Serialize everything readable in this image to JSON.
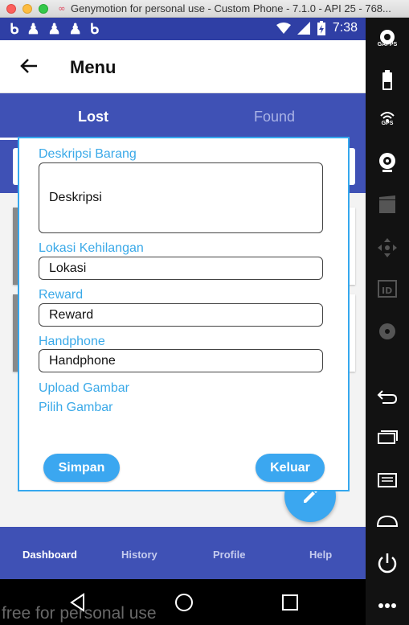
{
  "window": {
    "title": "Genymotion for personal use - Custom Phone - 7.1.0 - API 25 - 768..."
  },
  "status_bar": {
    "time": "7:38"
  },
  "app_bar": {
    "title": "Menu"
  },
  "tabs": [
    {
      "label": "Lost",
      "selected": true
    },
    {
      "label": "Found",
      "selected": false
    }
  ],
  "dialog": {
    "description_label": "Deskripsi Barang",
    "description_value": "Deskripsi",
    "location_label": "Lokasi Kehilangan",
    "location_value": "Lokasi",
    "reward_label": "Reward",
    "reward_value": "Reward",
    "phone_label": "Handphone",
    "phone_value": "Handphone",
    "upload_label": "Upload Gambar",
    "pick_image_label": "Pilih Gambar",
    "save_button": "Simpan",
    "exit_button": "Keluar"
  },
  "bottom_nav": {
    "items": [
      {
        "label": "Dashboard",
        "selected": true
      },
      {
        "label": "History",
        "selected": false
      },
      {
        "label": "Profile",
        "selected": false
      },
      {
        "label": "Help",
        "selected": false
      }
    ]
  },
  "genymotion_toolbar": {
    "gaps_label": "GAPPS",
    "gps_label": "GPS",
    "tools": [
      "gapps-icon",
      "battery-icon",
      "gps-icon",
      "webcam-icon",
      "media-icon",
      "dpad-icon",
      "device-id-icon",
      "disk-io-icon",
      "back-icon",
      "recent-apps-icon",
      "menu-icon",
      "home-icon",
      "power-icon",
      "more-icon"
    ]
  },
  "watermark": "free for personal use",
  "colors": {
    "primary": "#3f51b5",
    "status_bar": "#2f3fa5",
    "accent": "#3ba7f0",
    "label_blue": "#3aa9e8"
  }
}
